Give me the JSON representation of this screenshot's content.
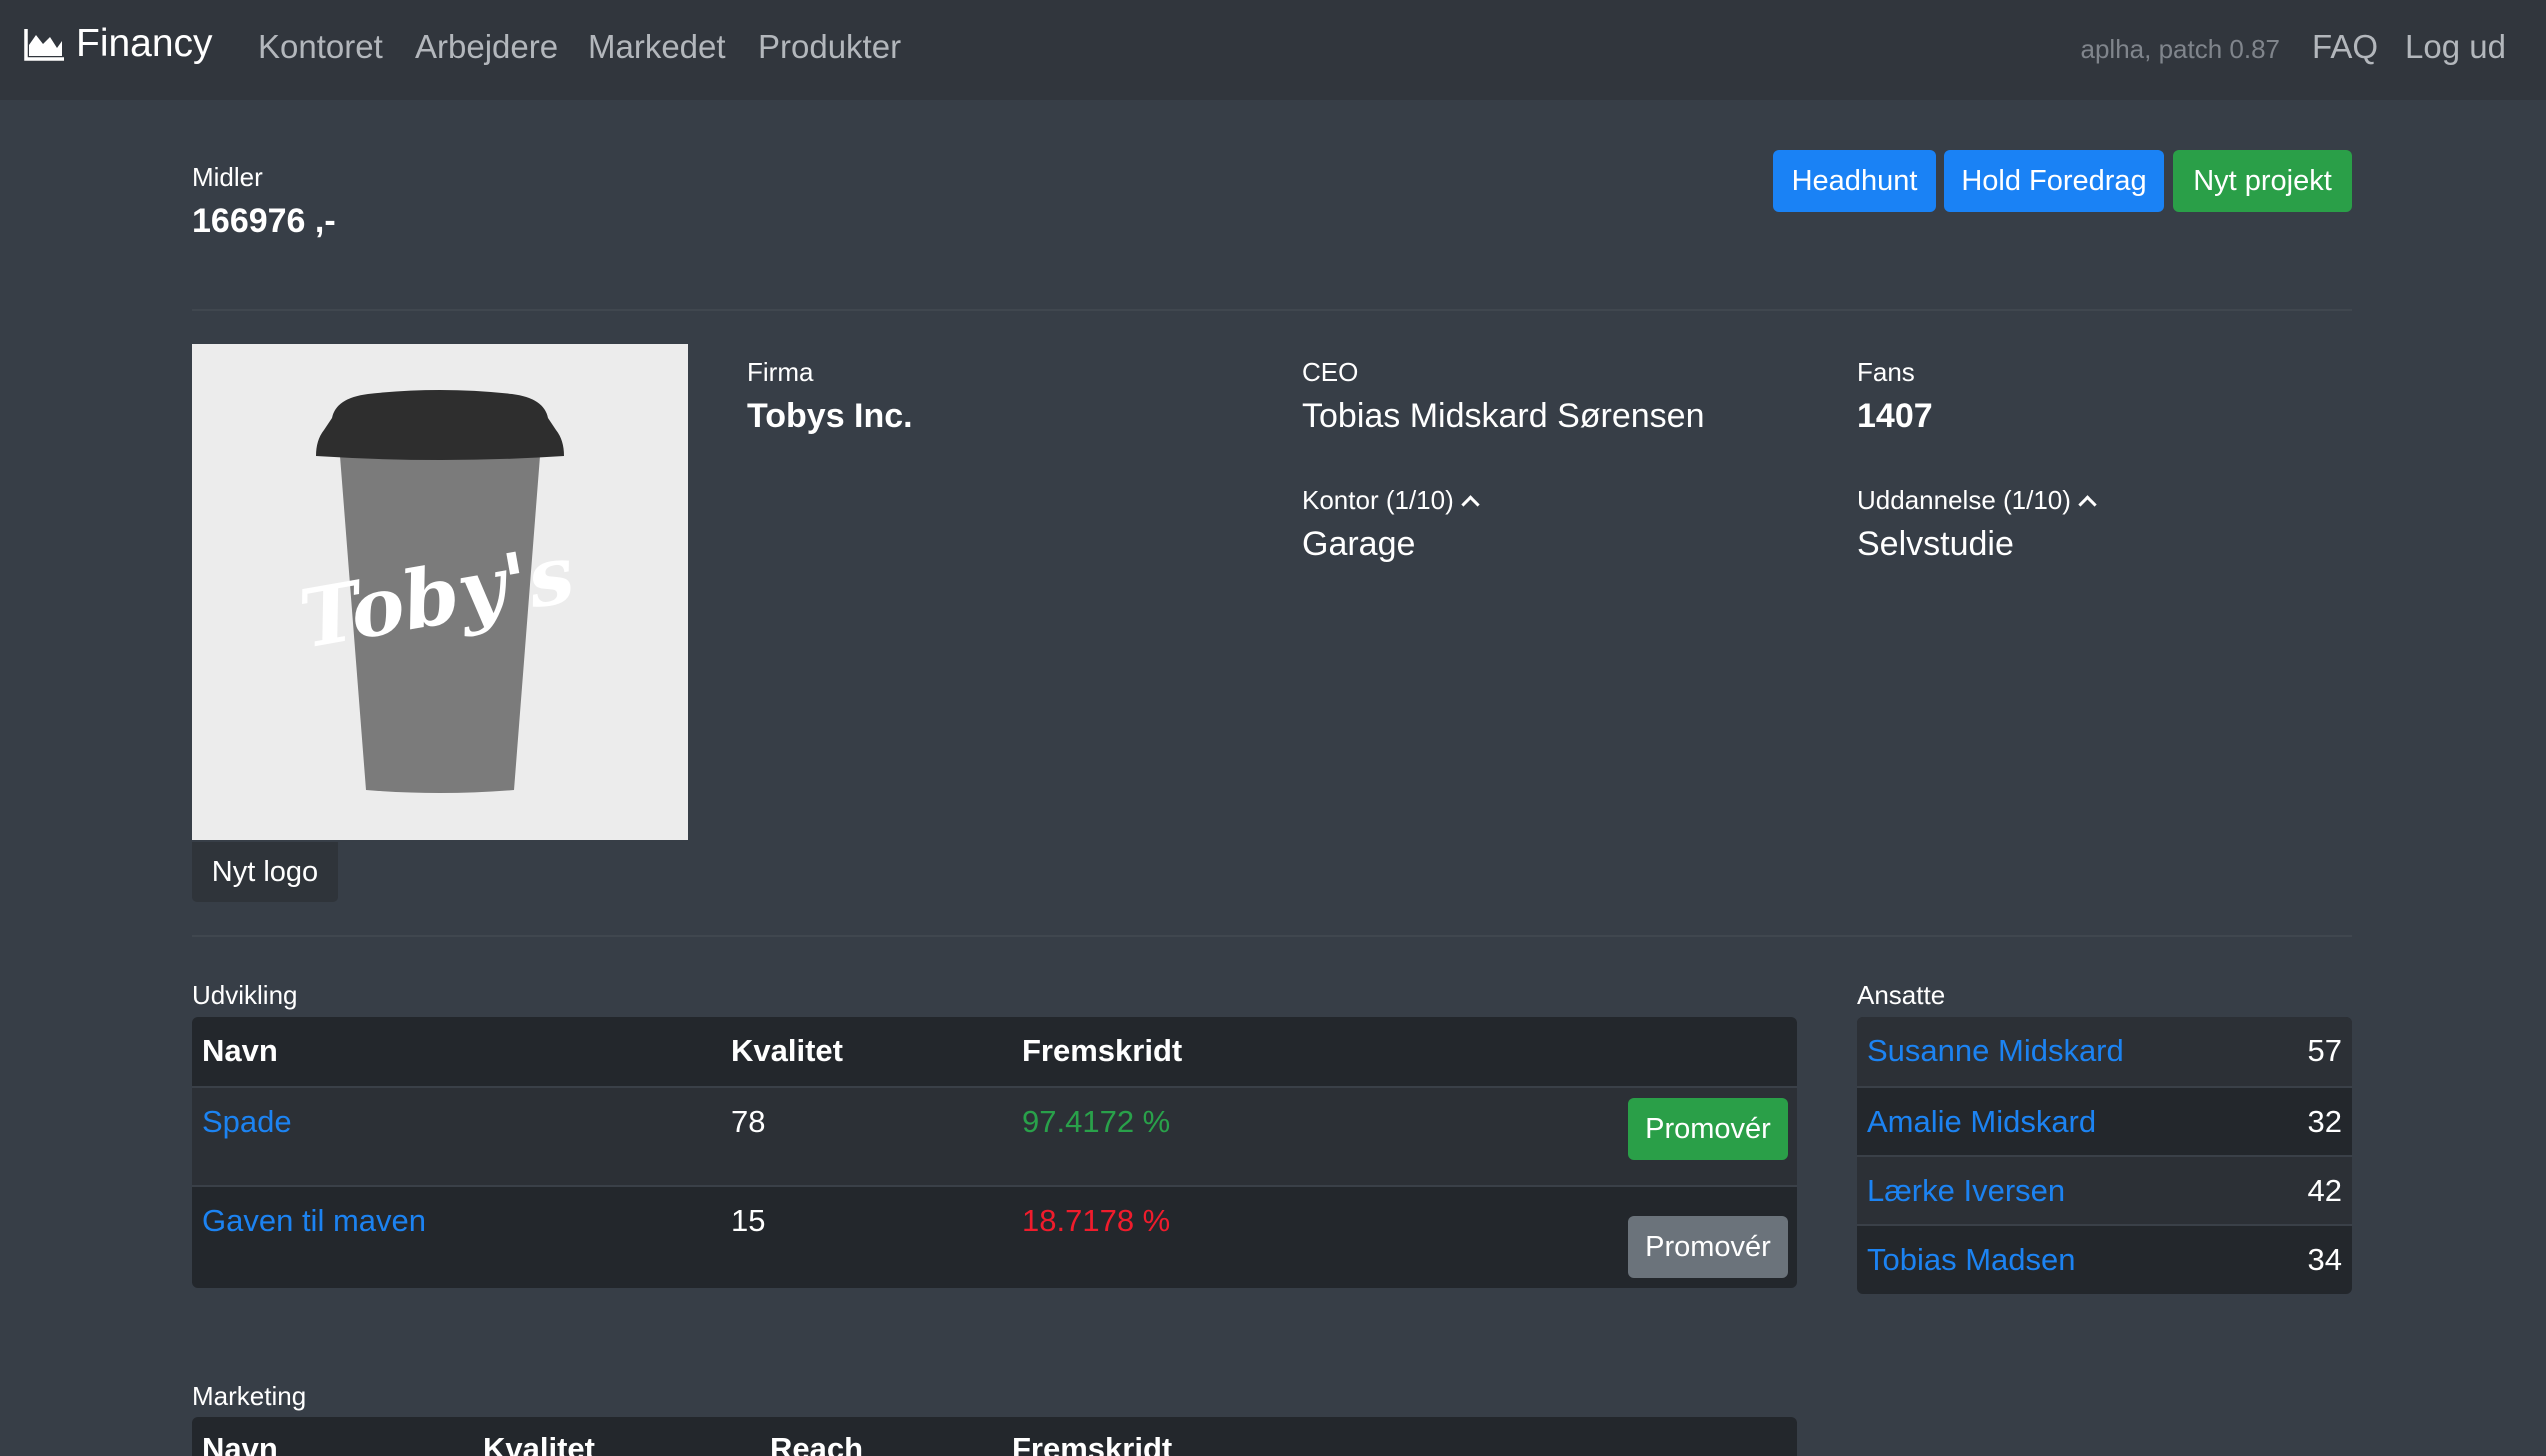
{
  "nav": {
    "brand": "Financy",
    "links": [
      "Kontoret",
      "Arbejdere",
      "Markedet",
      "Produkter"
    ],
    "version": "aplha, patch 0.87",
    "faq": "FAQ",
    "logout": "Log ud"
  },
  "funds": {
    "label": "Midler",
    "value": "166976 ,-"
  },
  "actions": {
    "headhunt": "Headhunt",
    "lecture": "Hold Foredrag",
    "new_project": "Nyt projekt"
  },
  "company": {
    "firm_label": "Firma",
    "firm_value": "Tobys Inc.",
    "ceo_label": "CEO",
    "ceo_value": "Tobias Midskard Sørensen",
    "fans_label": "Fans",
    "fans_value": "1407",
    "office_label": "Kontor (1/10)",
    "office_value": "Garage",
    "education_label": "Uddannelse (1/10)",
    "education_value": "Selvstudie",
    "logo_text": "Toby's",
    "new_logo_label": "Nyt logo"
  },
  "development": {
    "section_label": "Udvikling",
    "headers": [
      "Navn",
      "Kvalitet",
      "Fremskridt"
    ],
    "rows": [
      {
        "name": "Spade",
        "quality": "78",
        "progress": "97.4172 %",
        "progress_color": "#29a14a",
        "button": "Promovér",
        "button_state": "active"
      },
      {
        "name": "Gaven til maven",
        "quality": "15",
        "progress": "18.7178 %",
        "progress_color": "#f01c2c",
        "button": "Promovér",
        "button_state": "disabled"
      }
    ]
  },
  "employees": {
    "section_label": "Ansatte",
    "rows": [
      {
        "name": "Susanne Midskard",
        "value": "57"
      },
      {
        "name": "Amalie Midskard",
        "value": "32"
      },
      {
        "name": "Lærke Iversen",
        "value": "42"
      },
      {
        "name": "Tobias Madsen",
        "value": "34"
      }
    ]
  },
  "marketing": {
    "section_label": "Marketing",
    "headers": [
      "Navn",
      "Kvalitet",
      "Reach",
      "Fremskridt"
    ]
  },
  "colors": {
    "navbar": "#31363d",
    "background": "#373e47",
    "link": "#1c83f2",
    "primary": "#1a82f5",
    "success": "#2a9f48",
    "danger": "#f01c2c"
  }
}
